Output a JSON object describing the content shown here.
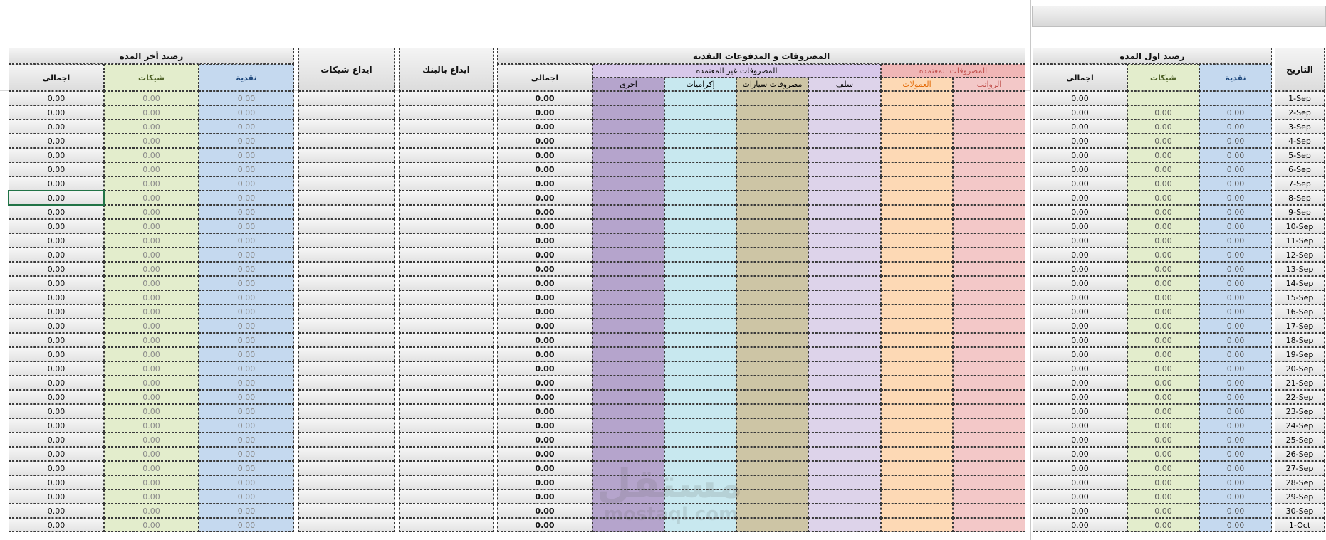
{
  "dates": [
    "1-Sep",
    "2-Sep",
    "3-Sep",
    "4-Sep",
    "5-Sep",
    "6-Sep",
    "7-Sep",
    "8-Sep",
    "9-Sep",
    "10-Sep",
    "11-Sep",
    "12-Sep",
    "13-Sep",
    "14-Sep",
    "15-Sep",
    "16-Sep",
    "17-Sep",
    "18-Sep",
    "19-Sep",
    "20-Sep",
    "21-Sep",
    "22-Sep",
    "23-Sep",
    "24-Sep",
    "25-Sep",
    "26-Sep",
    "27-Sep",
    "28-Sep",
    "29-Sep",
    "30-Sep",
    "1-Oct"
  ],
  "zero": "0.00",
  "headers": {
    "date": "التاريخ",
    "opening_title": "رصيد اول المدة",
    "closing_title": "رصيد أخر المدة",
    "cash": "نقدية",
    "cheques": "شيكات",
    "total": "اجمالى",
    "expenses_title": "المصروفات و المدفوعات النقدية",
    "approved": "المصروفات المعتمده",
    "unapproved": "المصروفات غير المعتمده",
    "salaries": "الرواتب",
    "commissions": "العمولات",
    "advances": "سلف",
    "car_expenses": "مصروفات سيارات",
    "bonuses": "إكراميات",
    "other": "اخرى",
    "bank_deposit": "ايداع بالبنك",
    "cheque_deposit": "ايداع شيكات"
  },
  "colors": {
    "cash": "#c5d9ef",
    "cheques": "#e3edcc",
    "total": "#e8e8e8",
    "salaries": "#f3c8c8",
    "commissions": "#fdd9b5",
    "advances": "#ddd3ea",
    "car_expenses": "#cdc5a5",
    "bonuses": "#c8e8ef",
    "other": "#b5a4cc",
    "approved_header": "#f0b6b6",
    "unapproved_header": "#d8c8ea",
    "salaries_text": "#c0504d",
    "commissions_text": "#e46c0a",
    "cheques_text": "#4f6228",
    "cash_text": "#1f497d"
  },
  "watermark": {
    "arabic": "مستقل",
    "latin": "mostaql.com"
  }
}
